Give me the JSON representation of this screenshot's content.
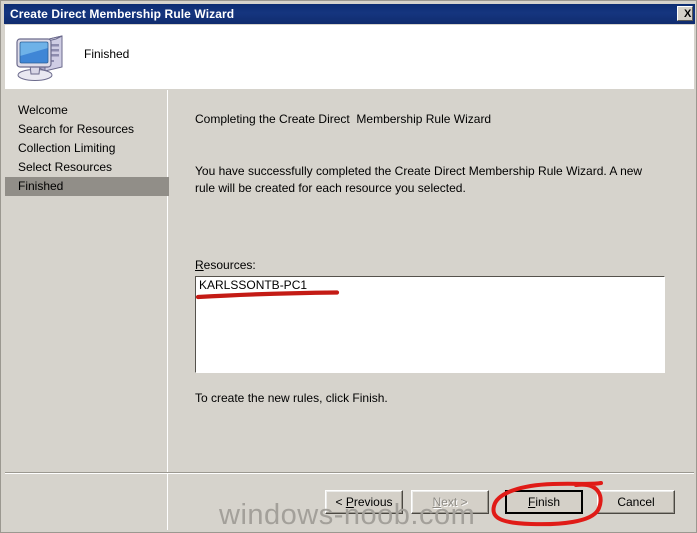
{
  "window": {
    "title": "Create Direct Membership Rule Wizard",
    "close_label": "X"
  },
  "header": {
    "icon": "computer-icon",
    "title": "Finished"
  },
  "sidebar": {
    "items": [
      {
        "label": "Welcome",
        "selected": false
      },
      {
        "label": "Search for Resources",
        "selected": false
      },
      {
        "label": "Collection Limiting",
        "selected": false
      },
      {
        "label": "Select Resources",
        "selected": false
      },
      {
        "label": "Finished",
        "selected": true
      }
    ]
  },
  "main": {
    "heading": "Completing the Create Direct  Membership Rule Wizard",
    "paragraph": "You have successfully completed the Create Direct Membership Rule Wizard. A new rule will be created for each resource you selected.",
    "resources_label_accel": "R",
    "resources_label_rest": "esources:",
    "resources": [
      "KARLSSONTB-PC1"
    ],
    "footer_note": "To create the new rules, click Finish."
  },
  "buttons": {
    "previous": {
      "pre": "< ",
      "accel": "P",
      "post": "revious",
      "disabled": false,
      "default": false
    },
    "next": {
      "pre": "",
      "accel": "N",
      "post": "ext >",
      "disabled": true,
      "default": false
    },
    "finish": {
      "pre": "",
      "accel": "F",
      "post": "inish",
      "disabled": false,
      "default": true
    },
    "cancel": {
      "pre": "Cancel",
      "accel": "",
      "post": "",
      "disabled": false,
      "default": false
    }
  },
  "annotations": {
    "underline_color": "#c41b15",
    "ellipse_color": "#e01b17",
    "underline_note": "red marker underline beneath KARLSSONTB-PC1",
    "ellipse_note": "red marker ellipse around Finish button"
  },
  "watermark": {
    "text": "windows-noob.com",
    "color": "#a3a09a"
  },
  "colors": {
    "titlebar": "#15357f",
    "dialog_face": "#d6d3cc",
    "selection": "#918e88",
    "field_background": "#ffffff"
  }
}
